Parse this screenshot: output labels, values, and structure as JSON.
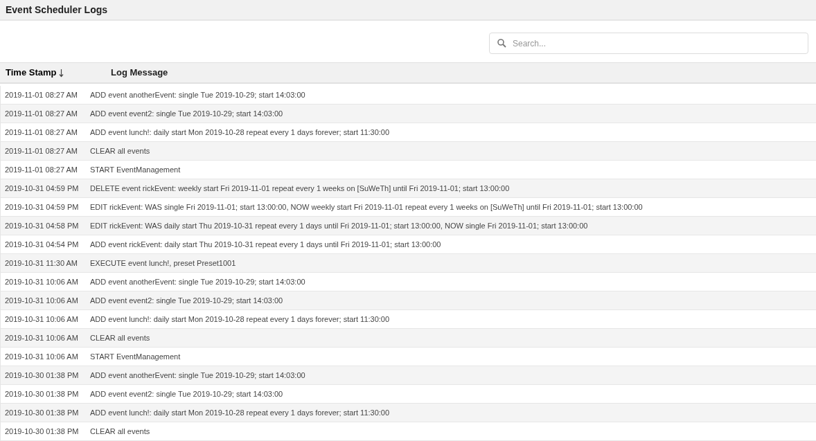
{
  "title": "Event Scheduler Logs",
  "search": {
    "placeholder": "Search..."
  },
  "table": {
    "columns": [
      {
        "label": "Time Stamp",
        "sorted": true
      },
      {
        "label": "Log Message",
        "sorted": false
      }
    ],
    "rows": [
      [
        "2019-11-01 08:27 AM",
        "ADD event anotherEvent: single Tue 2019-10-29; start 14:03:00"
      ],
      [
        "2019-11-01 08:27 AM",
        "ADD event event2: single Tue 2019-10-29; start 14:03:00"
      ],
      [
        "2019-11-01 08:27 AM",
        "ADD event lunch!: daily start Mon 2019-10-28 repeat every 1 days forever; start 11:30:00"
      ],
      [
        "2019-11-01 08:27 AM",
        "CLEAR all events"
      ],
      [
        "2019-11-01 08:27 AM",
        "START EventManagement"
      ],
      [
        "2019-10-31 04:59 PM",
        "DELETE event rickEvent: weekly start Fri 2019-11-01 repeat every 1 weeks on [SuWeTh] until Fri 2019-11-01; start 13:00:00"
      ],
      [
        "2019-10-31 04:59 PM",
        "EDIT rickEvent: WAS single Fri 2019-11-01; start 13:00:00, NOW weekly start Fri 2019-11-01 repeat every 1 weeks on [SuWeTh] until Fri 2019-11-01; start 13:00:00"
      ],
      [
        "2019-10-31 04:58 PM",
        "EDIT rickEvent: WAS daily start Thu 2019-10-31 repeat every 1 days until Fri 2019-11-01; start 13:00:00, NOW single Fri 2019-11-01; start 13:00:00"
      ],
      [
        "2019-10-31 04:54 PM",
        "ADD event rickEvent: daily start Thu 2019-10-31 repeat every 1 days until Fri 2019-11-01; start 13:00:00"
      ],
      [
        "2019-10-31 11:30 AM",
        "EXECUTE event lunch!, preset Preset1001"
      ],
      [
        "2019-10-31 10:06 AM",
        "ADD event anotherEvent: single Tue 2019-10-29; start 14:03:00"
      ],
      [
        "2019-10-31 10:06 AM",
        "ADD event event2: single Tue 2019-10-29; start 14:03:00"
      ],
      [
        "2019-10-31 10:06 AM",
        "ADD event lunch!: daily start Mon 2019-10-28 repeat every 1 days forever; start 11:30:00"
      ],
      [
        "2019-10-31 10:06 AM",
        "CLEAR all events"
      ],
      [
        "2019-10-31 10:06 AM",
        "START EventManagement"
      ],
      [
        "2019-10-30 01:38 PM",
        "ADD event anotherEvent: single Tue 2019-10-29; start 14:03:00"
      ],
      [
        "2019-10-30 01:38 PM",
        "ADD event event2: single Tue 2019-10-29; start 14:03:00"
      ],
      [
        "2019-10-30 01:38 PM",
        "ADD event lunch!: daily start Mon 2019-10-28 repeat every 1 days forever; start 11:30:00"
      ],
      [
        "2019-10-30 01:38 PM",
        "CLEAR all events"
      ]
    ]
  }
}
